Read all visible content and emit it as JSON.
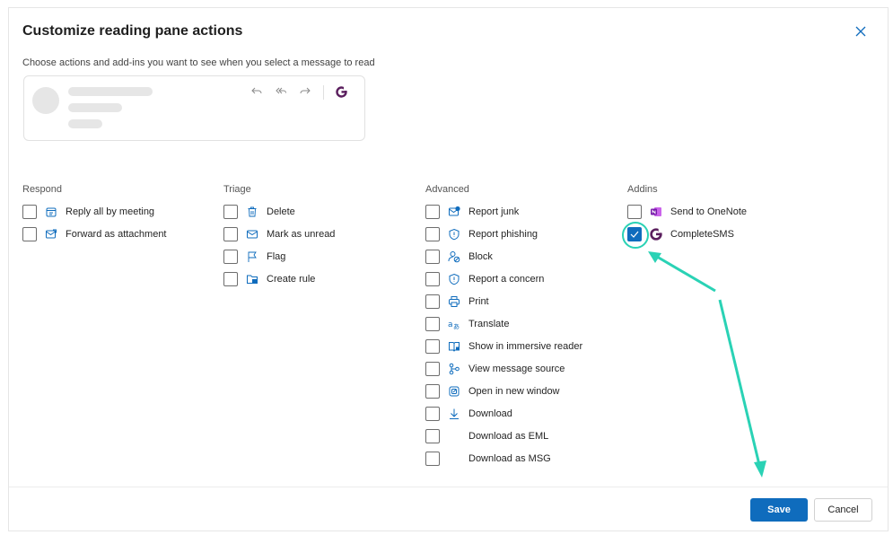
{
  "dialog": {
    "title": "Customize reading pane actions",
    "subtitle": "Choose actions and add-ins you want to see when you select a message to read"
  },
  "preview": {
    "icons": [
      "reply-icon",
      "reply-all-icon",
      "forward-icon",
      "completesms-icon"
    ]
  },
  "columns": {
    "respond": {
      "header": "Respond",
      "items": [
        {
          "label": "Reply all by meeting",
          "icon": "calendar-reply-icon",
          "checked": false
        },
        {
          "label": "Forward as attachment",
          "icon": "mail-attach-icon",
          "checked": false
        }
      ]
    },
    "triage": {
      "header": "Triage",
      "items": [
        {
          "label": "Delete",
          "icon": "trash-icon",
          "checked": false
        },
        {
          "label": "Mark as unread",
          "icon": "mail-icon",
          "checked": false
        },
        {
          "label": "Flag",
          "icon": "flag-icon",
          "checked": false
        },
        {
          "label": "Create rule",
          "icon": "folder-rule-icon",
          "checked": false
        }
      ]
    },
    "advanced": {
      "header": "Advanced",
      "items": [
        {
          "label": "Report junk",
          "icon": "mail-junk-icon",
          "checked": false
        },
        {
          "label": "Report phishing",
          "icon": "shield-icon",
          "checked": false
        },
        {
          "label": "Block",
          "icon": "block-user-icon",
          "checked": false
        },
        {
          "label": "Report a concern",
          "icon": "shield-alert-icon",
          "checked": false
        },
        {
          "label": "Print",
          "icon": "printer-icon",
          "checked": false
        },
        {
          "label": "Translate",
          "icon": "translate-icon",
          "checked": false
        },
        {
          "label": "Show in immersive reader",
          "icon": "immersive-reader-icon",
          "checked": false
        },
        {
          "label": "View message source",
          "icon": "source-icon",
          "checked": false
        },
        {
          "label": "Open in new window",
          "icon": "open-window-icon",
          "checked": false
        },
        {
          "label": "Download",
          "icon": "download-icon",
          "checked": false
        },
        {
          "label": "Download as EML",
          "icon": "",
          "checked": false
        },
        {
          "label": "Download as MSG",
          "icon": "",
          "checked": false
        }
      ]
    },
    "addins": {
      "header": "Addins",
      "items": [
        {
          "label": "Send to OneNote",
          "icon": "onenote-icon",
          "checked": false
        },
        {
          "label": "CompleteSMS",
          "icon": "completesms-icon",
          "checked": true
        }
      ]
    }
  },
  "footer": {
    "save_label": "Save",
    "cancel_label": "Cancel"
  },
  "colors": {
    "accent": "#0f6cbd",
    "annotation": "#2ad2b5",
    "completesms_brand": "#5b1f5e",
    "onenote_brand": "#7719aa"
  }
}
